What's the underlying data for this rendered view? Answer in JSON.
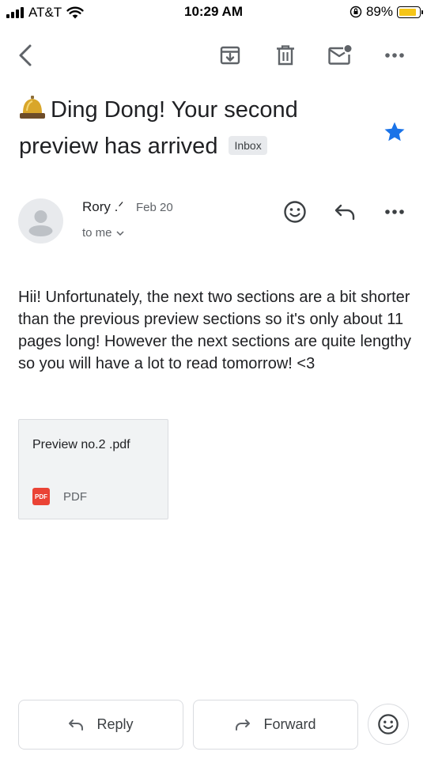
{
  "status_bar": {
    "carrier": "AT&T",
    "time": "10:29 AM",
    "battery_percent": "89%",
    "battery_level": 0.89,
    "battery_color": "#f5c518"
  },
  "toolbar": {
    "back_icon": "chevron-left-icon",
    "archive_icon": "archive-icon",
    "delete_icon": "trash-icon",
    "mark_unread_icon": "mark-unread-icon",
    "more_icon": "more-horizontal-icon"
  },
  "email": {
    "subject": "Ding Dong! Your second preview has arrived",
    "subject_emoji": "bell-icon",
    "label_chip": "Inbox",
    "starred": true,
    "star_color": "#1a73e8",
    "sender_name": "Rory .ᐟ",
    "date": "Feb 20",
    "recipient": "to me",
    "body": "Hii! Unfortunately, the next two sections are a bit shorter than the previous preview sections so it's only about 11 pages long! However the next sections are quite lengthy so you will have a lot to read tomorrow! <3"
  },
  "attachment": {
    "file_name": "Preview no.2 .pdf",
    "type_badge": "PDF",
    "type_label": "PDF",
    "badge_color": "#ea4335"
  },
  "actions": {
    "reply_label": "Reply",
    "forward_label": "Forward"
  }
}
